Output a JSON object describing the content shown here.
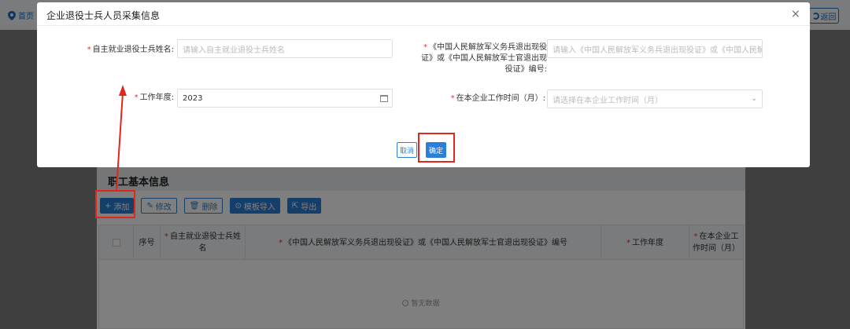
{
  "topbar": {
    "home_label": "首页",
    "back_label": "返回"
  },
  "section": {
    "title": "职工基本信息"
  },
  "toolbar": {
    "add": "添加",
    "edit": "修改",
    "delete": "删除",
    "import": "模板导入",
    "export": "导出"
  },
  "table": {
    "headers": {
      "index": "序号",
      "name": "自主就业退役士兵姓名",
      "cert": "《中国人民解放军义务兵退出现役证》或《中国人民解放军士官退出现役证》编号",
      "year": "工作年度",
      "time": "在本企业工作时间（月）"
    },
    "empty_text": "暂无数据"
  },
  "dialog": {
    "title": "企业退役士兵人员采集信息",
    "close": "×",
    "name_label": "自主就业退役士兵姓名:",
    "name_placeholder": "请输入自主就业退役士兵姓名",
    "cert_label": "《中国人民解放军义务兵退出现役证》或《中国人民解放军士官退出现役证》编号:",
    "cert_placeholder": "请输入《中国人民解放军义务兵退出现役证》或《中国人民解放军士官退出现役证》编号",
    "year_label": "工作年度:",
    "year_value": "2023",
    "time_label": "在本企业工作时间（月）:",
    "time_placeholder": "请选择在本企业工作时间（月）",
    "cancel": "取消",
    "ok": "确定"
  },
  "colors": {
    "primary": "#2b7fd6",
    "required": "#e0352b",
    "annotation": "#e2261c"
  }
}
